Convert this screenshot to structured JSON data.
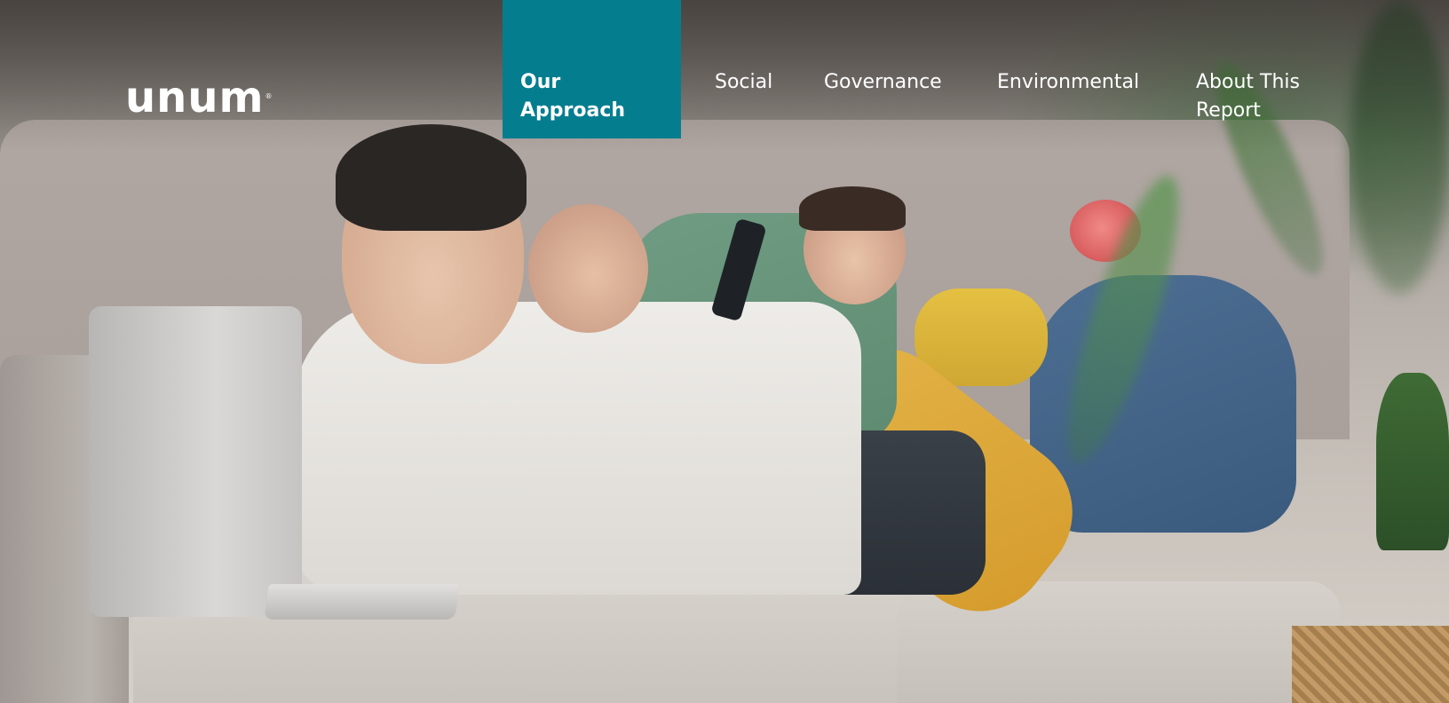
{
  "brand": {
    "logo_text": "unum",
    "registered_mark": "®"
  },
  "nav": {
    "items": [
      {
        "label": "Our Approach",
        "active": true
      },
      {
        "label": "Social",
        "active": false
      },
      {
        "label": "Governance",
        "active": false
      },
      {
        "label": "Environmental",
        "active": false
      },
      {
        "label": "About This Report",
        "active": false
      }
    ]
  },
  "colors": {
    "nav_active_bg": "#047d8f",
    "nav_text": "#ffffff"
  },
  "hero_image": {
    "icon": "family-on-sofa-photo"
  }
}
